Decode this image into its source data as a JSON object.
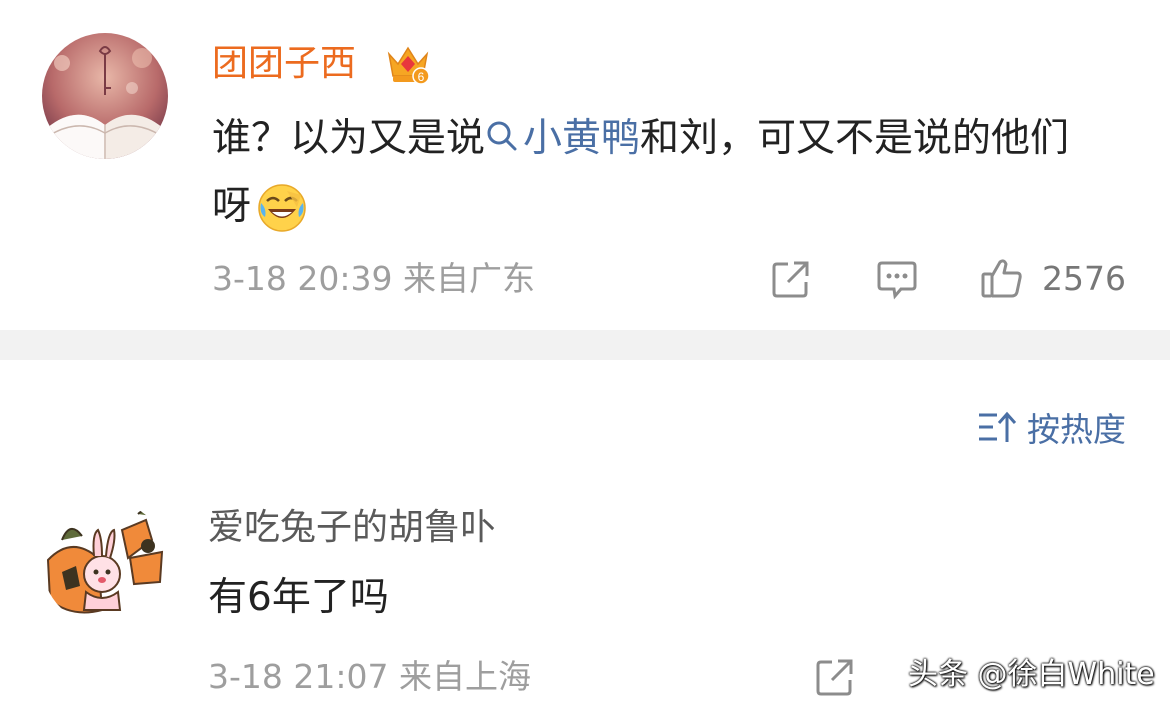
{
  "post": {
    "username": "团团子西",
    "badge_level": "6",
    "text_before_topic": "谁？以为又是说",
    "topic": "小黄鸭",
    "text_after_topic": "和刘，可又不是说的他们呀",
    "emoji": "laughing-crying-emoji",
    "date": "3-18 20:39",
    "location": "来自广东",
    "like_count": "2576"
  },
  "sort": {
    "label": "按热度"
  },
  "reply": {
    "username": "爱吃兔子的胡鲁卟",
    "text": "有6年了吗",
    "date": "3-18 21:07",
    "location": "来自上海"
  },
  "watermark": {
    "text": "头条 @徐白White"
  },
  "colors": {
    "username_orange": "#ec6b1f",
    "link_blue": "#4a6fa5",
    "meta_gray": "#9e9e9e",
    "divider_band": "#f2f2f2"
  },
  "icons": [
    "crown-badge-icon",
    "search-mini-icon",
    "share-icon",
    "comment-icon",
    "like-icon",
    "sort-icon"
  ]
}
